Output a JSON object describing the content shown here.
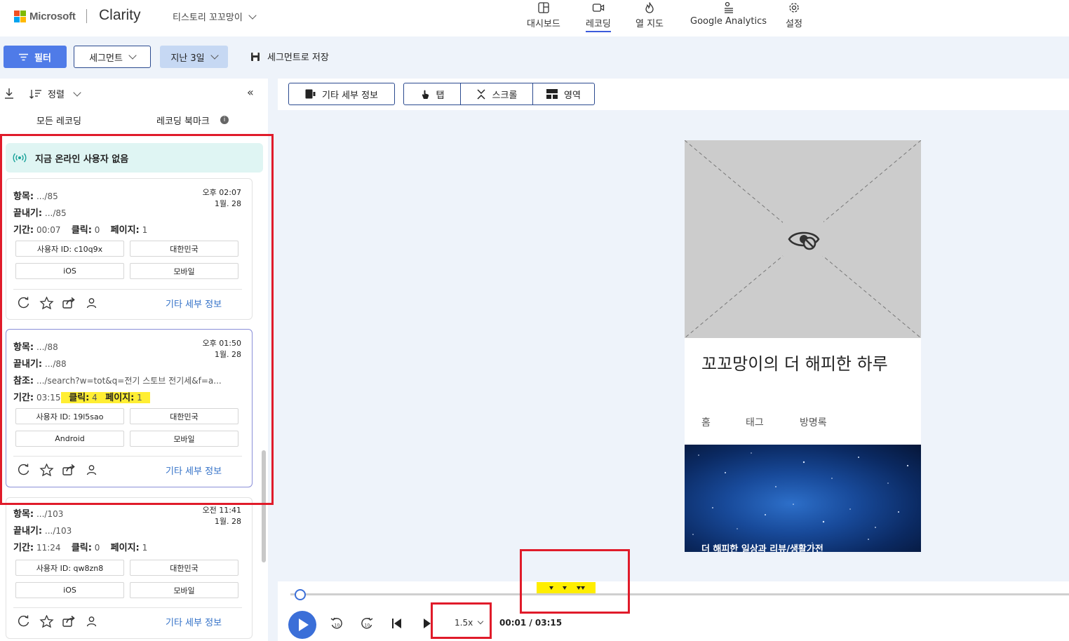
{
  "header": {
    "brand": "Microsoft",
    "app_name": "Clarity",
    "project": "티스토리 꼬꼬망이",
    "nav": [
      {
        "label": "대시보드",
        "icon": "dashboard-icon"
      },
      {
        "label": "레코딩",
        "icon": "video-icon",
        "active": true
      },
      {
        "label": "열 지도",
        "icon": "flame-icon"
      },
      {
        "label": "Google Analytics",
        "icon": "analytics-icon"
      },
      {
        "label": "설정",
        "icon": "gear-icon"
      }
    ]
  },
  "toolbar": {
    "filter_label": "필터",
    "segment_label": "세그먼트",
    "date_label": "지난 3일",
    "save_segment_label": "세그먼트로 저장"
  },
  "left_panel": {
    "sort_label": "정렬",
    "tabs": [
      "모든 레코딩",
      "레코딩 북마크"
    ],
    "online_status": "지금 온라인 사용자 없음",
    "recordings": [
      {
        "entry_label": "항목:",
        "entry_value": ".../85",
        "exit_label": "끝내기:",
        "exit_value": ".../85",
        "duration_label": "기간:",
        "duration": "00:07",
        "clicks_label": "클릭:",
        "clicks": "0",
        "pages_label": "페이지:",
        "pages": "1",
        "time": "오후 02:07",
        "date": "1월. 28",
        "chips": [
          "사용자 ID: c10q9x",
          "대한민국",
          "iOS",
          "모바일"
        ],
        "more_label": "기타 세부 정보"
      },
      {
        "entry_label": "항목:",
        "entry_value": ".../88",
        "exit_label": "끝내기:",
        "exit_value": ".../88",
        "referrer_label": "참조:",
        "referrer_value": ".../search?w=tot&q=전기 스토브 전기세&f=a...",
        "duration_label": "기간:",
        "duration": "03:15",
        "clicks_label": "클릭:",
        "clicks": "4",
        "pages_label": "페이지:",
        "pages": "1",
        "time": "오후 01:50",
        "date": "1월. 28",
        "chips": [
          "사용자 ID: 19l5sao",
          "대한민국",
          "Android",
          "모바일"
        ],
        "more_label": "기타 세부 정보"
      },
      {
        "entry_label": "항목:",
        "entry_value": ".../103",
        "exit_label": "끝내기:",
        "exit_value": ".../103",
        "duration_label": "기간:",
        "duration": "11:24",
        "clicks_label": "클릭:",
        "clicks": "0",
        "pages_label": "페이지:",
        "pages": "1",
        "time": "오전 11:41",
        "date": "1월. 28",
        "chips": [
          "사용자 ID: qw8zn8",
          "대한민국",
          "iOS",
          "모바일"
        ],
        "more_label": "기타 세부 정보"
      }
    ]
  },
  "main": {
    "tools": {
      "details_label": "기타 세부 정보",
      "tap_label": "탭",
      "scroll_label": "스크롤",
      "area_label": "영역"
    },
    "preview": {
      "blog_title": "꼬꼬망이의 더 해피한 하루",
      "nav": [
        "홈",
        "태그",
        "방명록"
      ],
      "caption": "더 해피한 일상과 리뷰/생활가전"
    },
    "player": {
      "speed": "1.5x",
      "timecode": "00:01 / 03:15",
      "progress": 0.005
    }
  },
  "colors": {
    "accent": "#3b6fd8",
    "annotation_red": "#e01b2a",
    "highlight_yellow": "#ffee33",
    "online_bg": "#dff5f3"
  }
}
